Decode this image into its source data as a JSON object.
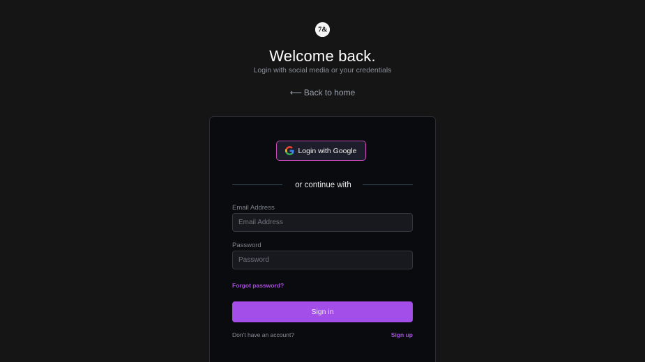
{
  "header": {
    "title": "Welcome back.",
    "subtitle": "Login with social media or your credentials",
    "back_arrow": "⟵",
    "back_label": "Back to home"
  },
  "logo": {
    "icon": "typography-logo-icon",
    "glyph": "7&"
  },
  "social": {
    "google_label": "Login with Google",
    "google_icon": "google-g-icon"
  },
  "divider": {
    "text": "or continue with"
  },
  "form": {
    "email_label": "Email Address",
    "email_placeholder": "Email Address",
    "email_value": "",
    "password_label": "Password",
    "password_placeholder": "Password",
    "password_value": "",
    "forgot_label": "Forgot password?",
    "signin_label": "Sign in",
    "no_account_text": "Don't have an account?",
    "signup_label": "Sign up"
  },
  "colors": {
    "background": "#151515",
    "card": "#0a0b0e",
    "accent": "#a44eea",
    "google_border": "#c84ab7"
  }
}
